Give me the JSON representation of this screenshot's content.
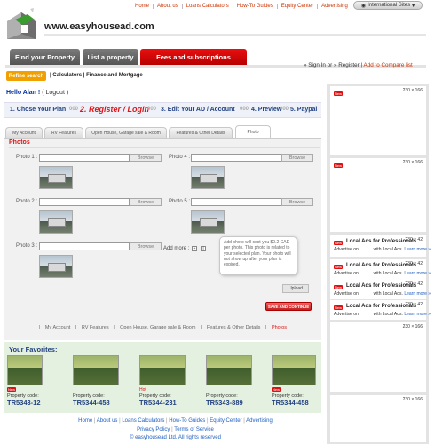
{
  "top_nav": {
    "links": [
      "Home",
      "About us",
      "Loans Calculators",
      "How-To Guides",
      "Equity Center",
      "Advertising"
    ],
    "international": "International Sites"
  },
  "logo": {
    "url_text": "www.easyhousead.com"
  },
  "main_tabs": [
    "Find your Property",
    "List a property",
    "Fees and subscriptions"
  ],
  "active_tab": "Fees and subscriptions",
  "account": {
    "sign_in": "Sign In",
    "or": "or",
    "register": "Register",
    "compare": "Add to Compare list"
  },
  "sub_nav": {
    "refine": "Refine search",
    "calculators": "Calculators",
    "finance": "Finance and Mortgage"
  },
  "hello": {
    "text": "Hello Alan !",
    "logout": "( Logout )"
  },
  "steps": {
    "s1": "1. Chose Your Plan",
    "s2": "2. Register / Login",
    "s3": "3. Edit Your AD / Account",
    "s4": "4. Preview",
    "s5": "5. Paypal",
    "arrow": "000"
  },
  "inner_tabs": [
    "My Account",
    "RV Features",
    "Open House, Garage sale & Room",
    "Features & Other Details",
    "Photo"
  ],
  "photos": {
    "heading": "Photos",
    "browse": "Browse",
    "labels": [
      "Photo 1 :",
      "Photo 2 :",
      "Photo 3 :",
      "Photo 4 :",
      "Photo 5 :"
    ],
    "add_more": "Add more :",
    "tooltip": "Add photo will cost you $0.2 CAD per photo. This photo is related to your selected plan. Your photo will not show up after your plan is expired.",
    "upload": "Upload",
    "save_continue": "SAVE AND CONTINUE"
  },
  "bottom_tabs": [
    "My Account",
    "RV Features",
    "Open House, Garage sale & Room",
    "Features & Other Details",
    "Photos"
  ],
  "favorites": {
    "heading": "Your Favorites:",
    "code_label": "Property code:",
    "new_badge": "New",
    "hot_badge": "Hot",
    "items": [
      {
        "code": "TR5343-12",
        "badge": "New"
      },
      {
        "code": "TR5344-458",
        "badge": ""
      },
      {
        "code": "TR5344-231",
        "badge": "Hot"
      },
      {
        "code": "TR5343-889",
        "badge": ""
      },
      {
        "code": "TR5344-458",
        "badge": "New"
      }
    ]
  },
  "footer": {
    "links": [
      "Home",
      "About us",
      "Loans Calculators",
      "How-To Guides",
      "Equity Center",
      "Advertising"
    ],
    "policy": "Privacy Policy",
    "terms": "Terms of Service",
    "copyright": "© easyhousead Ltd. All rights reserved"
  },
  "sidebar": {
    "big_ad_size": "230 × 166",
    "small_ad_size": "230 × 42",
    "new_badge": "New",
    "small_ad_title": "Local Ads for Professionals",
    "small_ad_desc": "Advertise on",
    "small_ad_desc2": "with Local Ads.",
    "learn_more": "Learn more »"
  },
  "colors": {
    "accent_red": "#e81010",
    "nav_blue": "#1f3f80",
    "orange": "#f0a000"
  }
}
